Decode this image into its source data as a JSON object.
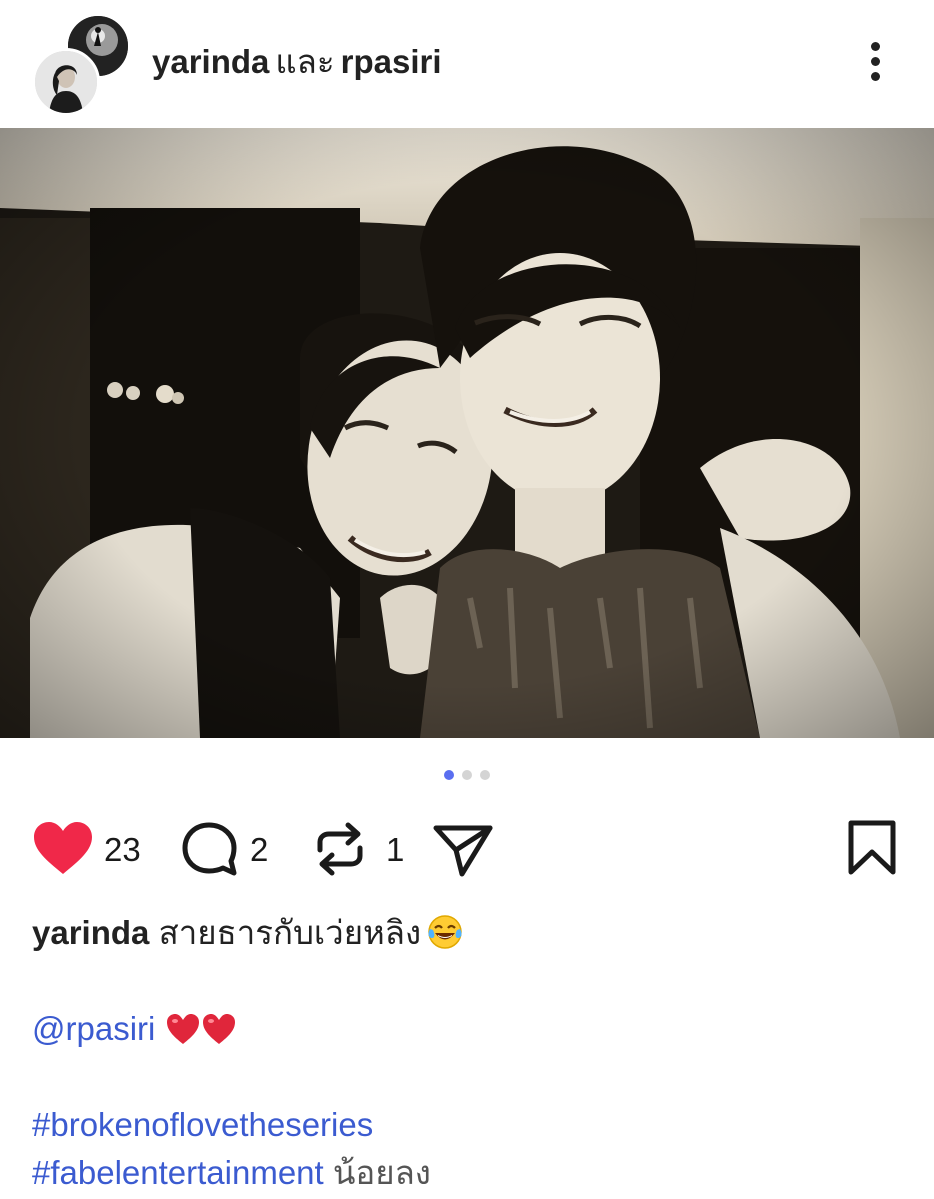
{
  "header": {
    "user1": "yarinda",
    "conjunction": "และ",
    "user2": "rpasiri"
  },
  "carousel": {
    "total": 3,
    "active_index": 0
  },
  "actions": {
    "likes": "23",
    "comments": "2",
    "reposts": "1",
    "like_color": "#f02849"
  },
  "caption": {
    "author": "yarinda",
    "text": "สายธารกับเว่ยหลิง",
    "emoji": "face-with-tears-of-joy",
    "mention": "@rpasiri",
    "mention_emoji": "red-heart x2",
    "hashtag1": "#brokenoflovetheseries",
    "hashtag2": "#fabelentertainment",
    "less_label": "น้อยลง"
  },
  "colors": {
    "link": "#3b5bd0",
    "active_dot": "#5a6ef0",
    "inactive_dot": "#d4d4d4"
  }
}
